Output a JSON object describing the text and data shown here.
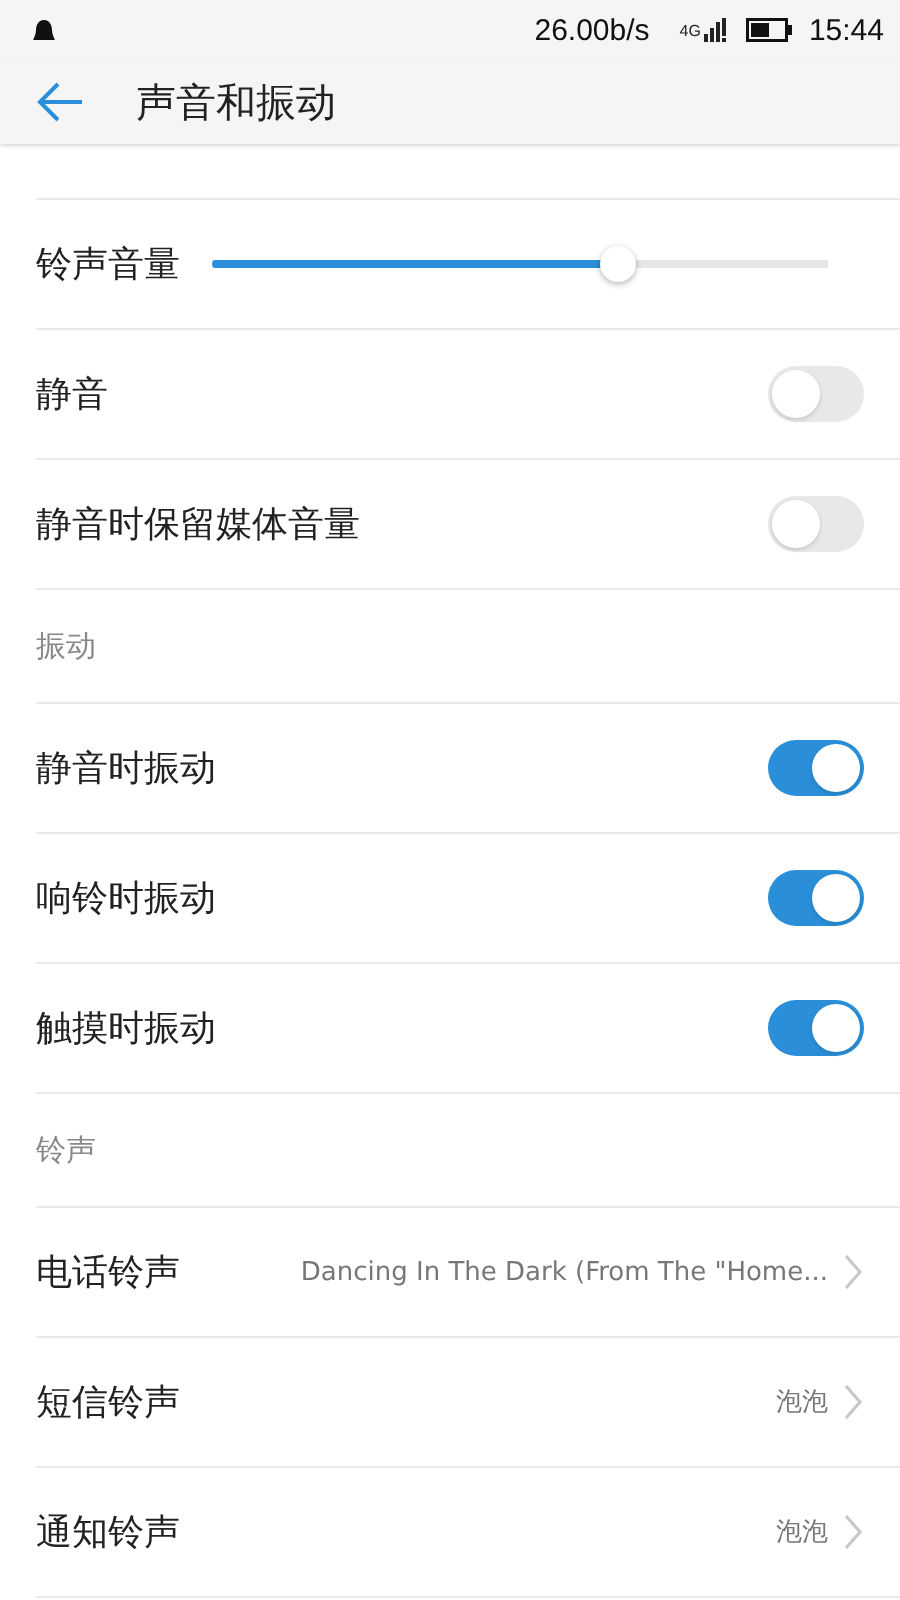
{
  "status_bar": {
    "network_speed": "26.00b/s",
    "network_type": "4G",
    "time": "15:44"
  },
  "header": {
    "title": "声音和振动"
  },
  "items": [
    {
      "kind": "partial"
    },
    {
      "kind": "slider",
      "label": "铃声音量",
      "level": 0.66
    },
    {
      "kind": "toggle",
      "label": "静音",
      "on": false
    },
    {
      "kind": "toggle",
      "label": "静音时保留媒体音量",
      "on": false
    },
    {
      "kind": "section",
      "label": "振动"
    },
    {
      "kind": "toggle",
      "label": "静音时振动",
      "on": true
    },
    {
      "kind": "toggle",
      "label": "响铃时振动",
      "on": true
    },
    {
      "kind": "toggle",
      "label": "触摸时振动",
      "on": true
    },
    {
      "kind": "section",
      "label": "铃声"
    },
    {
      "kind": "link",
      "label": "电话铃声",
      "value": "Dancing In The Dark (From The \"Home..."
    },
    {
      "kind": "link",
      "label": "短信铃声",
      "value": "泡泡"
    },
    {
      "kind": "link",
      "label": "通知铃声",
      "value": "泡泡"
    }
  ]
}
